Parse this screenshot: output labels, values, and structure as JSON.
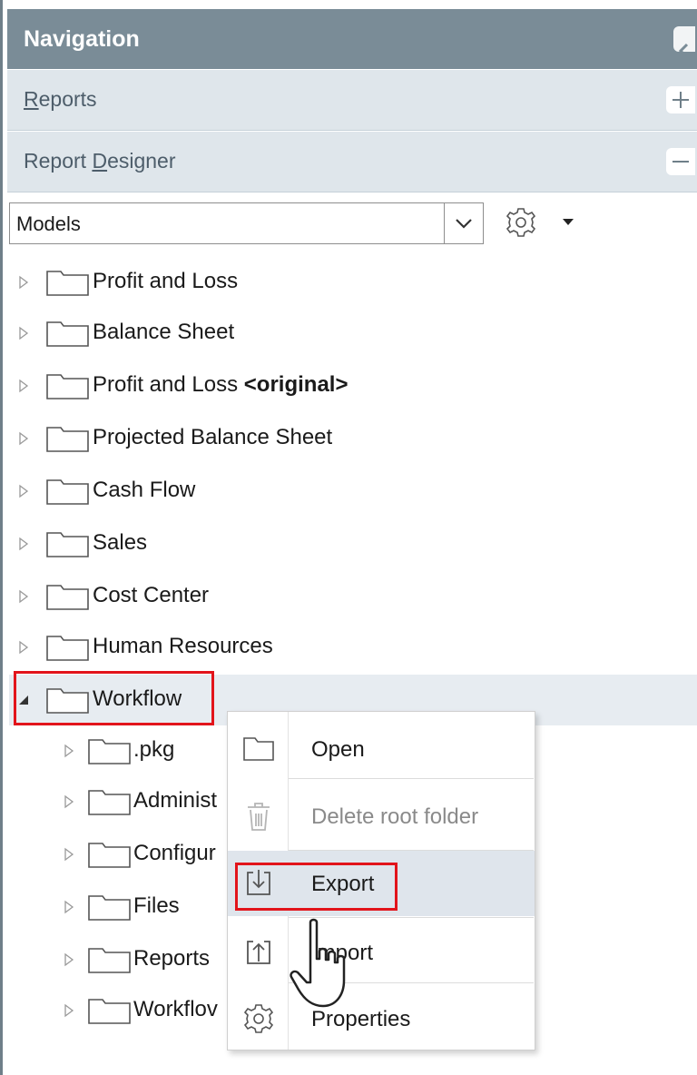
{
  "navigation": {
    "title": "Navigation",
    "sections": [
      {
        "label": "Reports",
        "access_key": "R",
        "rest": "eports",
        "button": "plus"
      },
      {
        "label": "Report Designer",
        "prefix": "Report ",
        "access_key": "D",
        "rest": "esigner",
        "button": "minus"
      }
    ]
  },
  "toolbar": {
    "models_value": "Models",
    "icons": [
      "chevron-down-icon",
      "gear-icon",
      "caret-down-icon"
    ]
  },
  "tree": {
    "items": [
      {
        "label": "Profit and Loss"
      },
      {
        "label": "Balance Sheet"
      },
      {
        "label": "Profit and Loss",
        "suffix": "<original>"
      },
      {
        "label": "Projected Balance Sheet"
      },
      {
        "label": "Cash Flow"
      },
      {
        "label": "Sales"
      },
      {
        "label": "Cost Center"
      },
      {
        "label": "Human Resources"
      },
      {
        "label": "Workflow",
        "expanded": true,
        "selected": true
      }
    ],
    "children": [
      {
        "label": ".pkg"
      },
      {
        "label": "Administ"
      },
      {
        "label": "Configur"
      },
      {
        "label": "Files"
      },
      {
        "label": "Reports"
      },
      {
        "label": "Workflov"
      }
    ]
  },
  "context_menu": {
    "items": [
      {
        "label": "Open",
        "icon": "folder-icon",
        "enabled": true
      },
      {
        "label": "Delete root folder",
        "icon": "trash-icon",
        "enabled": false
      },
      {
        "label": "Export",
        "icon": "export-icon",
        "enabled": true,
        "hovered": true
      },
      {
        "label": "Import",
        "display": "Import",
        "icon": "import-icon",
        "enabled": true
      },
      {
        "label": "Properties",
        "icon": "gear-icon",
        "enabled": true
      }
    ]
  },
  "colors": {
    "header_bg": "#7a8c97",
    "section_bg": "#dfe6eb",
    "highlight": "#e2141b",
    "hover_bg": "#dfe5ec"
  }
}
